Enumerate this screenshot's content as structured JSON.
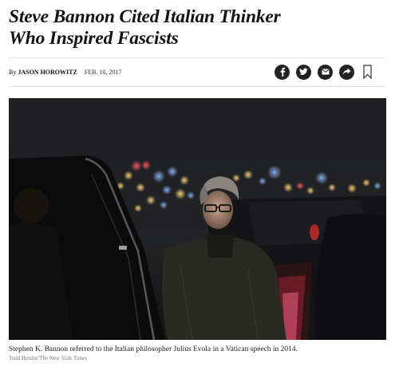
{
  "article": {
    "headline_line1": "Steve Bannon Cited Italian Thinker",
    "headline_line2": "Who Inspired Fascists",
    "byline_prefix": "By",
    "author": "JASON HOROWITZ",
    "date": "FEB. 10, 2017"
  },
  "share": {
    "icons": [
      "facebook-icon",
      "twitter-icon",
      "email-icon",
      "share-arrow-icon",
      "bookmark-icon"
    ]
  },
  "photo": {
    "caption": "Stephen K. Bannon referred to the Italian philosopher Julius Evola in a Vatican speech in 2014.",
    "credit": "Todd Heisler/The New York Times"
  }
}
